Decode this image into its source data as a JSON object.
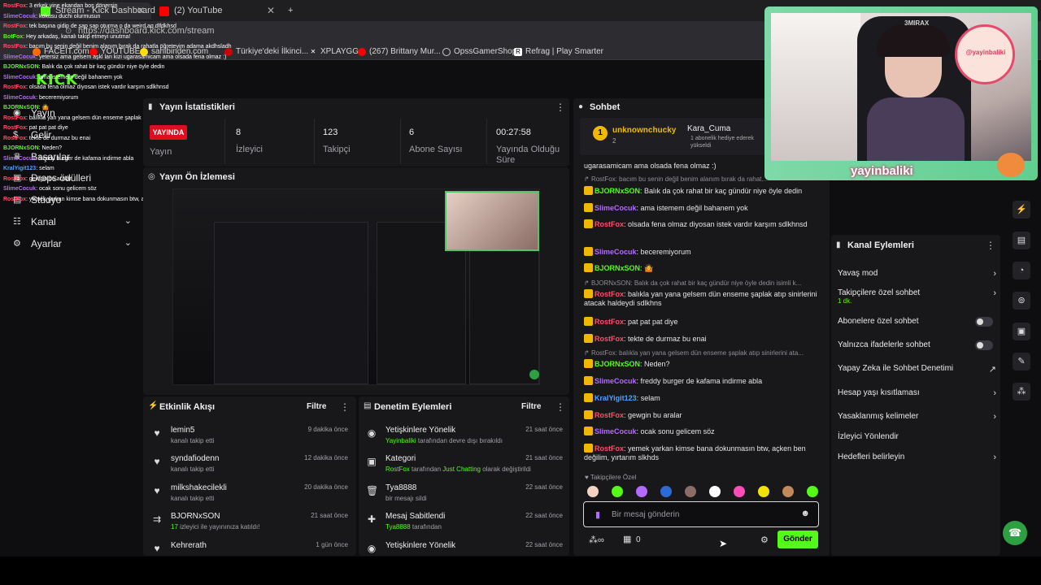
{
  "browser": {
    "tabs": [
      {
        "label": "Stream - Kick Dashboard",
        "active": true
      },
      {
        "label": "(2) YouTube",
        "active": false
      }
    ],
    "new_tab": "+",
    "url": "https://dashboard.kick.com/stream",
    "bookmarks": [
      "FACEIT.com",
      "YOUTUBE",
      "sahibinden.com",
      "Türkiye'deki İlkinci...",
      "XPLAYGG",
      "(267) Brittany Mur...",
      "OpssGamerShop",
      "Refrag | Play Smarter"
    ]
  },
  "sidebar": {
    "logo": "KICK",
    "items": [
      {
        "label": "Yayın",
        "icon": "broadcast-icon",
        "chevron": false
      },
      {
        "label": "Gelir",
        "icon": "money-icon",
        "chevron": false
      },
      {
        "label": "Başarılar",
        "icon": "trophy-icon",
        "chevron": false
      },
      {
        "label": "Drops ödülleri",
        "icon": "gift-icon",
        "chevron": false
      },
      {
        "label": "Stüdyo",
        "icon": "studio-icon",
        "chevron": false
      },
      {
        "label": "Kanal",
        "icon": "channel-icon",
        "chevron": true
      },
      {
        "label": "Ayarlar",
        "icon": "gear-icon",
        "chevron": true
      }
    ]
  },
  "stats": {
    "title": "Yayın İstatistikleri",
    "live_badge": "YAYINDA",
    "items": [
      {
        "label": "Yayın",
        "value": ""
      },
      {
        "label": "İzleyici",
        "value": "8"
      },
      {
        "label": "Takipçi",
        "value": "123"
      },
      {
        "label": "Abone Sayısı",
        "value": "6"
      },
      {
        "label": "Yayında Olduğu Süre",
        "value": "00:27:58"
      }
    ]
  },
  "preview": {
    "title": "Yayın Ön İzlemesi"
  },
  "activity": {
    "title": "Etkinlik Akışı",
    "filter": "Filtre",
    "rows": [
      {
        "name": "lemin5",
        "sub": "kanalı takip etti",
        "time": "9 dakika önce",
        "icon": "heart-icon"
      },
      {
        "name": "syndafiodenn",
        "sub": "kanalı takip etti",
        "time": "12 dakika önce",
        "icon": "heart-icon"
      },
      {
        "name": "milkshakecilekli",
        "sub": "kanalı takip etti",
        "time": "20 dakika önce",
        "icon": "heart-icon"
      },
      {
        "name": "BJORNxSON",
        "sub_highlight": "17",
        "sub": " izleyici ile yayınınıza katıldı!",
        "time": "21 saat önce",
        "icon": "raid-icon"
      },
      {
        "name": "Kehrerath",
        "sub": "",
        "time": "1 gün önce",
        "icon": "heart-icon"
      }
    ]
  },
  "moderation": {
    "title": "Denetim Eylemleri",
    "filter": "Filtre",
    "rows": [
      {
        "name": "Yetişkinlere Yönelik",
        "actor": "Yayinbaliki",
        "sub": " tarafından devre dışı bırakıldı",
        "time": "21 saat önce",
        "icon": "eye-icon"
      },
      {
        "name": "Kategori",
        "actor": "RostFox",
        "sub": " tarafından ",
        "sub2": "Just Chatting",
        "sub3": " olarak değiştirildi",
        "time": "21 saat önce",
        "icon": "category-icon"
      },
      {
        "name": "Tya8888",
        "actor": "",
        "sub": "bir mesajı sildi",
        "time": "22 saat önce",
        "icon": "trash-icon"
      },
      {
        "name": "Mesaj Sabitlendi",
        "actor": "Tya8888",
        "sub": " tarafından",
        "time": "22 saat önce",
        "icon": "pin-icon"
      },
      {
        "name": "Yetişkinlere Yönelik",
        "actor": "",
        "sub": "",
        "time": "22 saat önce",
        "icon": "eye-icon"
      }
    ]
  },
  "chat": {
    "title": "Sohbet",
    "pinned": {
      "user": "unknownchucky",
      "count": "2",
      "gifter": "Kara_Cuma",
      "gift_text": "1 abonelik hediye ederek yükseldi"
    },
    "messages": [
      {
        "type": "text",
        "user": "",
        "text": "ugarasamicam ama olsada fena olmaz :)"
      },
      {
        "type": "reply",
        "text": "RostFox: bacım bu senin değil benim alanım bırak da rahat..."
      },
      {
        "type": "text",
        "user": "BJORNxSON",
        "color": "#53fc18",
        "text": "Balık da çok rahat bir kaç gündür niye öyle dedin"
      },
      {
        "type": "text",
        "user": "SlimeCocuk",
        "color": "#b36bff",
        "text": "ama istemem değil bahanem yok"
      },
      {
        "type": "text",
        "user": "RostFox",
        "color": "#ff4d6a",
        "text": "olsada fena olmaz diyosan istek vardır karşım sdlkhnsd"
      },
      {
        "type": "text",
        "user": "SlimeCocuk",
        "color": "#b36bff",
        "text": "beceremiyorum"
      },
      {
        "type": "text",
        "user": "BJORNxSON",
        "color": "#53fc18",
        "text": "🤷"
      },
      {
        "type": "reply",
        "text": "BJORNxSON: Balık da çok rahat bir kaç gündür niye öyle dedin isimli k..."
      },
      {
        "type": "text",
        "user": "RostFox",
        "color": "#ff4d6a",
        "text": "balıkla yan yana gelsem dün enseme şaplak atıp sinirlerini atacak haldeydi sdlkhns"
      },
      {
        "type": "text",
        "user": "RostFox",
        "color": "#ff4d6a",
        "text": "pat pat pat diye"
      },
      {
        "type": "text",
        "user": "RostFox",
        "color": "#ff4d6a",
        "text": "tekte de durmaz bu enai"
      },
      {
        "type": "reply",
        "text": "RostFox: balıkla yan yana gelsem dün enseme şaplak atıp sinirlerini ata..."
      },
      {
        "type": "text",
        "user": "BJORNxSON",
        "color": "#53fc18",
        "text": "Neden?"
      },
      {
        "type": "text",
        "user": "SlimeCocuk",
        "color": "#b36bff",
        "text": "freddy burger de kafama indirme abla"
      },
      {
        "type": "text",
        "user": "KralYigit123",
        "color": "#4fa3ff",
        "text": "selam"
      },
      {
        "type": "text",
        "user": "RostFox",
        "color": "#ff4d6a",
        "text": "gewgin bu aralar"
      },
      {
        "type": "text",
        "user": "SlimeCocuk",
        "color": "#b36bff",
        "text": "ocak sonu gelicem söz"
      },
      {
        "type": "text",
        "user": "RostFox",
        "color": "#ff4d6a",
        "text": "yemek yarkan kimse bana dokunmasın btw, açken ben değilim, yırtarım slkhds"
      }
    ],
    "emote_label": "Takipçilere Özel",
    "input_placeholder": "Bir mesaj gönderin",
    "points": "0",
    "send": "Gönder"
  },
  "channel_actions": {
    "title": "Kanal Eylemleri",
    "items": [
      {
        "label": "Yavaş mod",
        "control": "chevron"
      },
      {
        "label": "Takipçilere özel sohbet",
        "sub": "1 dk.",
        "control": "chevron"
      },
      {
        "label": "Abonelere özel sohbet",
        "control": "toggle"
      },
      {
        "label": "Yalnızca ifadelerle sohbet",
        "control": "toggle"
      },
      {
        "label": "Yapay Zeka ile Sohbet Denetimi",
        "control": "external"
      },
      {
        "label": "Hesap yaşı kısıtlaması",
        "control": "chevron"
      },
      {
        "label": "Yasaklanmış kelimeler",
        "control": "chevron"
      },
      {
        "label": "İzleyici Yönlendir",
        "control": "none"
      },
      {
        "label": "Hedefleri belirleyin",
        "control": "chevron"
      }
    ]
  },
  "webcam": {
    "brand": "3MIRAX",
    "name": "yayinbaliki",
    "logo_text": "@yayinbaliki"
  },
  "overlay_chat": [
    {
      "user": "RostFox",
      "text": "3 erkek yine ekandan boş dönersin"
    },
    {
      "user": "SlimeCocuk",
      "text": "kokusu duchi olurmusun"
    },
    {
      "user": "RostFox",
      "text": "tek başına gidip de sap sap oturma o da weird aq dlfdkhsd"
    },
    {
      "user": "BotFox",
      "text": "Hey arkadaş, kanalı takip etmeyi unutma!"
    },
    {
      "user": "RostFox",
      "text": "bacım bu senin değil benim alanım bırak da rahatla öğreteyim adama akdhsladh"
    },
    {
      "user": "SlimeCocuk",
      "text": "yetersiz ama gelsem aşkl lan kizi ugarasamicam ama olsada fena olmaz :)"
    },
    {
      "user": "BJORNxSON",
      "text": "Balık da çok rahat bir kaç gündür niye öyle dedin"
    },
    {
      "user": "SlimeCocuk",
      "text": "ama istemem değil bahanem yok"
    },
    {
      "user": "RostFox",
      "text": "olsada fena olmaz diyosan istek vardır karşım sdlkhnsd"
    },
    {
      "user": "SlimeCocuk",
      "text": "beceremiyorum"
    },
    {
      "user": "BJORNxSON",
      "text": "🤷"
    },
    {
      "user": "RostFox",
      "text": "balıkla yan yana gelsem dün enseme şaplak atıp sinirlerini atacak haldeydi sdlkhns"
    },
    {
      "user": "RostFox",
      "text": "pat pat pat diye"
    },
    {
      "user": "RostFox",
      "text": "tekte de durmaz bu enai"
    },
    {
      "user": "BJORNxSON",
      "text": "Neden?"
    },
    {
      "user": "SlimeCocuk",
      "text": "freddy burger de kafama indirme abla"
    },
    {
      "user": "KralYigit123",
      "text": "selam"
    },
    {
      "user": "RostFox",
      "text": "gewgin bu aralar"
    },
    {
      "user": "SlimeCocuk",
      "text": "ocak sonu gelicem söz"
    },
    {
      "user": "RostFox",
      "text": "yemek yarkan kimse bana dokunmasın btw, açken ben değilim, yırtarım slkhds"
    }
  ],
  "colors": {
    "accent": "#53fc18",
    "live": "#e00d1f",
    "panel": "#18181b",
    "bg": "#0e0e10"
  }
}
